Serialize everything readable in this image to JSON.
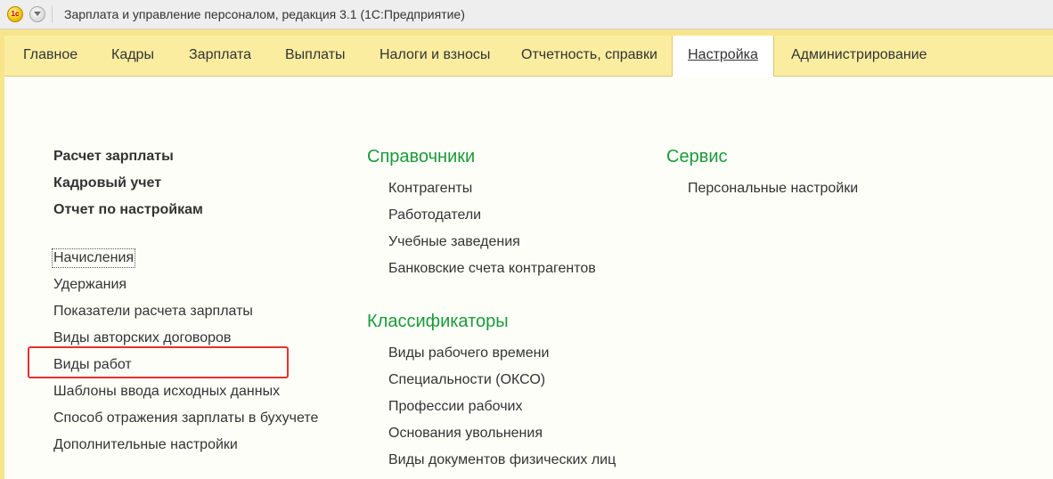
{
  "window": {
    "title": "Зарплата и управление персоналом, редакция 3.1  (1С:Предприятие)",
    "logo_text": "1с"
  },
  "sections": {
    "tabs": [
      {
        "label": "Главное"
      },
      {
        "label": "Кадры"
      },
      {
        "label": "Зарплата"
      },
      {
        "label": "Выплаты"
      },
      {
        "label": "Налоги и взносы"
      },
      {
        "label": "Отчетность, справки"
      },
      {
        "label": "Настройка"
      },
      {
        "label": "Администрирование"
      }
    ],
    "active": "Настройка"
  },
  "main": {
    "column1": {
      "bold_items": [
        "Расчет зарплаты",
        "Кадровый учет",
        "Отчет по настройкам"
      ],
      "items": [
        "Начисления",
        "Удержания",
        "Показатели расчета зарплаты",
        "Виды авторских договоров",
        "Виды работ",
        "Шаблоны ввода исходных данных",
        "Способ отражения зарплаты в бухучете",
        "Дополнительные настройки"
      ],
      "highlighted_item": "Виды работ"
    },
    "column2": {
      "groups": [
        {
          "title": "Справочники",
          "items": [
            "Контрагенты",
            "Работодатели",
            "Учебные заведения",
            "Банковские счета контрагентов"
          ]
        },
        {
          "title": "Классификаторы",
          "items": [
            "Виды рабочего времени",
            "Специальности (ОКСО)",
            "Профессии рабочих",
            "Основания увольнения",
            "Виды документов физических лиц"
          ]
        }
      ]
    },
    "column3": {
      "groups": [
        {
          "title": "Сервис",
          "items": [
            "Персональные настройки"
          ]
        }
      ]
    }
  },
  "colors": {
    "section_panel": "#fbeda0",
    "group_title": "#1a9a3a",
    "highlight": "#e2332b"
  }
}
